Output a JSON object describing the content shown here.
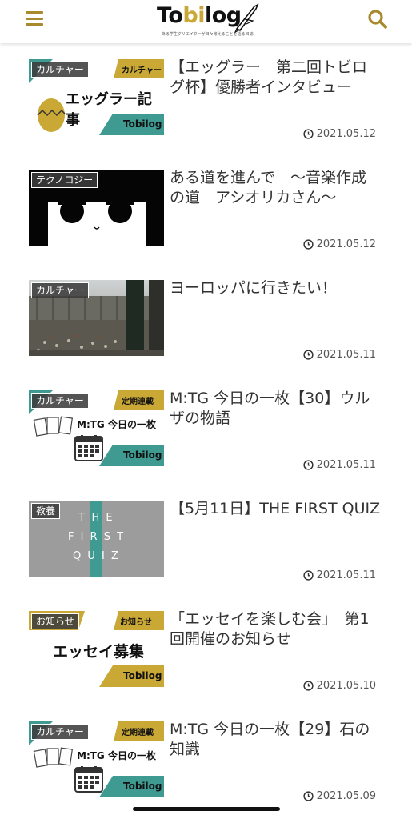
{
  "header": {
    "logo_text_pre": "To",
    "logo_text_i": "bi",
    "logo_text_post": "log",
    "logo_tagline": "ある学生クリエイターが日々考えることを語る日誌",
    "menu_icon": "hamburger-menu-icon",
    "search_icon": "search-icon"
  },
  "colors": {
    "accent": "#a8892d",
    "teal": "#3f9a92",
    "gold": "#c9a836"
  },
  "articles": [
    {
      "category": "カルチャー",
      "title": "【エッグラー　第二回トビログ杯】優勝者インタビュー",
      "date": "2021.05.12",
      "thumb": {
        "badge": "カルチャー",
        "headline": "エッグラー記事",
        "logo": "Tobilog"
      }
    },
    {
      "category": "テクノロジー",
      "title": "ある道を進んで　〜音楽作成の道　アシオリカさん〜",
      "date": "2021.05.12",
      "thumb": {}
    },
    {
      "category": "カルチャー",
      "title": "ヨーロッパに行きたい！",
      "date": "2021.05.11",
      "thumb": {}
    },
    {
      "category": "カルチャー",
      "title": "M:TG 今日の一枚【30】ウルザの物語",
      "date": "2021.05.11",
      "thumb": {
        "badge": "定期連載",
        "headline": "M:TG 今日の一枚",
        "logo": "Tobilog"
      }
    },
    {
      "category": "教養",
      "title": "【5月11日】THE FIRST QUIZ",
      "date": "2021.05.11",
      "thumb": {
        "line1": "T H E",
        "line2": "F I R S T",
        "line3": "Q U I Z"
      }
    },
    {
      "category": "お知らせ",
      "title": "「エッセイを楽しむ会」　第1回開催のお知らせ",
      "date": "2021.05.10",
      "thumb": {
        "badge": "お知らせ",
        "headline": "エッセイ募集",
        "logo": "Tobilog"
      }
    },
    {
      "category": "カルチャー",
      "title": "M:TG 今日の一枚【29】石の知識",
      "date": "2021.05.09",
      "thumb": {
        "badge": "定期連載",
        "headline": "M:TG 今日の一枚",
        "logo": "Tobilog"
      }
    }
  ]
}
